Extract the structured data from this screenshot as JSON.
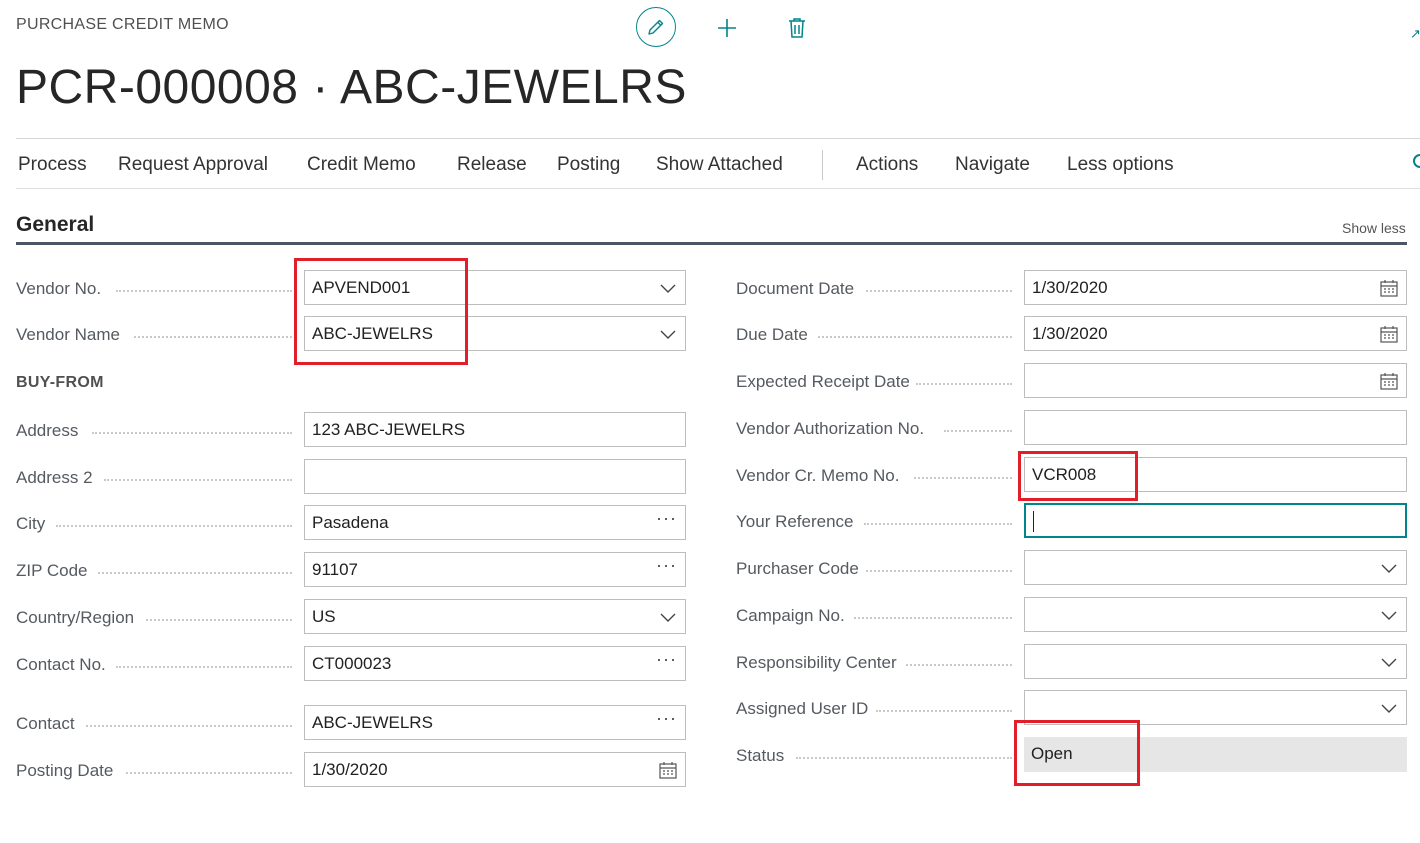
{
  "header": {
    "caption": "PURCHASE CREDIT MEMO",
    "title": "PCR-000008 · ABC-JEWELRS"
  },
  "toolbar": {
    "edit_icon": "pencil-icon",
    "new_icon": "plus-icon",
    "delete_icon": "trash-icon"
  },
  "actions": [
    "Process",
    "Request Approval",
    "Credit Memo",
    "Release",
    "Posting",
    "Show Attached",
    "Actions",
    "Navigate",
    "Less options"
  ],
  "section": {
    "title": "General",
    "toggle": "Show less"
  },
  "left_fields": {
    "vendor_no": {
      "label": "Vendor No.",
      "value": "APVEND001"
    },
    "vendor_name": {
      "label": "Vendor Name",
      "value": "ABC-JEWELRS"
    },
    "buy_from_header": "BUY-FROM",
    "address": {
      "label": "Address",
      "value": "123 ABC-JEWELRS"
    },
    "address2": {
      "label": "Address 2",
      "value": ""
    },
    "city": {
      "label": "City",
      "value": "Pasadena"
    },
    "zip": {
      "label": "ZIP Code",
      "value": "91107"
    },
    "country": {
      "label": "Country/Region",
      "value": "US"
    },
    "contact_no": {
      "label": "Contact No.",
      "value": "CT000023"
    },
    "contact": {
      "label": "Contact",
      "value": "ABC-JEWELRS"
    },
    "posting_date": {
      "label": "Posting Date",
      "value": "1/30/2020"
    }
  },
  "right_fields": {
    "document_date": {
      "label": "Document Date",
      "value": "1/30/2020"
    },
    "due_date": {
      "label": "Due Date",
      "value": "1/30/2020"
    },
    "expected_receipt_date": {
      "label": "Expected Receipt Date",
      "value": ""
    },
    "vendor_auth_no": {
      "label": "Vendor Authorization No.",
      "value": ""
    },
    "vendor_cr_memo_no": {
      "label": "Vendor Cr. Memo No.",
      "value": "VCR008"
    },
    "your_reference": {
      "label": "Your Reference",
      "value": ""
    },
    "purchaser_code": {
      "label": "Purchaser Code",
      "value": ""
    },
    "campaign_no": {
      "label": "Campaign No.",
      "value": ""
    },
    "responsibility_center": {
      "label": "Responsibility Center",
      "value": ""
    },
    "assigned_user_id": {
      "label": "Assigned User ID",
      "value": ""
    },
    "status": {
      "label": "Status",
      "value": "Open"
    }
  },
  "colors": {
    "accent": "#00858a",
    "highlight": "#e21e2b",
    "section_rule": "#4a5663",
    "readonly_bg": "#e6e6e6"
  }
}
